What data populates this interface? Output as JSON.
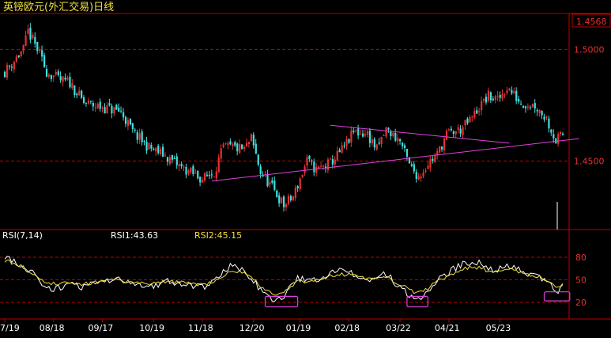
{
  "header": {
    "title": "英镑欧元(外汇交易)日线",
    "top_price": "1.4568"
  },
  "colors": {
    "background": "#000000",
    "frame": "#c00000",
    "grid": "#c00000",
    "up": "#e83030",
    "down": "#40e0e0",
    "trendline": "#e040e0",
    "rsi1": "#ffffff",
    "rsi2": "#f0e040",
    "axis_text": "#ffffff",
    "price_label": "#e83030",
    "title": "#f0e040"
  },
  "chart_data": [
    {
      "type": "candlestick",
      "title": "英镑欧元(外汇交易)日线",
      "ylim": [
        1.42,
        1.515
      ],
      "y_ticks": [
        {
          "value": 1.5,
          "label": "1.5000"
        },
        {
          "value": 1.45,
          "label": "1.4500"
        }
      ],
      "current_price_label": "1.4568",
      "x_labels": [
        "7/19",
        "08/18",
        "09/17",
        "10/19",
        "11/18",
        "12/20",
        "01/19",
        "02/18",
        "03/22",
        "04/21",
        "05/23"
      ],
      "x_label_index": [
        0,
        21,
        42,
        64,
        85,
        107,
        127,
        148,
        170,
        191,
        213
      ],
      "anchor_closes": [
        [
          0,
          1.49
        ],
        [
          8,
          1.5
        ],
        [
          10,
          1.508
        ],
        [
          14,
          1.5
        ],
        [
          18,
          1.49
        ],
        [
          24,
          1.486
        ],
        [
          28,
          1.485
        ],
        [
          34,
          1.476
        ],
        [
          42,
          1.474
        ],
        [
          50,
          1.472
        ],
        [
          55,
          1.463
        ],
        [
          62,
          1.456
        ],
        [
          68,
          1.453
        ],
        [
          76,
          1.447
        ],
        [
          85,
          1.442
        ],
        [
          90,
          1.445
        ],
        [
          94,
          1.456
        ],
        [
          98,
          1.456
        ],
        [
          103,
          1.455
        ],
        [
          106,
          1.46
        ],
        [
          110,
          1.445
        ],
        [
          115,
          1.438
        ],
        [
          120,
          1.43
        ],
        [
          124,
          1.434
        ],
        [
          130,
          1.45
        ],
        [
          134,
          1.446
        ],
        [
          140,
          1.449
        ],
        [
          146,
          1.456
        ],
        [
          150,
          1.463
        ],
        [
          156,
          1.462
        ],
        [
          160,
          1.455
        ],
        [
          164,
          1.464
        ],
        [
          170,
          1.459
        ],
        [
          174,
          1.448
        ],
        [
          178,
          1.443
        ],
        [
          182,
          1.449
        ],
        [
          186,
          1.453
        ],
        [
          190,
          1.462
        ],
        [
          196,
          1.464
        ],
        [
          200,
          1.468
        ],
        [
          204,
          1.474
        ],
        [
          208,
          1.479
        ],
        [
          212,
          1.477
        ],
        [
          216,
          1.483
        ],
        [
          222,
          1.476
        ],
        [
          228,
          1.475
        ],
        [
          233,
          1.469
        ],
        [
          237,
          1.459
        ],
        [
          240,
          1.462
        ]
      ],
      "trendlines": [
        {
          "points": [
            [
              89,
              1.441
            ],
            [
              247,
              1.46
            ]
          ]
        },
        {
          "points": [
            [
              140,
              1.466
            ],
            [
              217,
              1.458
            ]
          ]
        }
      ]
    },
    {
      "type": "line",
      "title": "RSI(7,14)",
      "series": [
        {
          "name": "RSI1",
          "current": 43.63,
          "anchors": [
            [
              0,
              82
            ],
            [
              6,
              72
            ],
            [
              12,
              60
            ],
            [
              16,
              42
            ],
            [
              22,
              38
            ],
            [
              28,
              45
            ],
            [
              34,
              40
            ],
            [
              42,
              48
            ],
            [
              48,
              52
            ],
            [
              56,
              44
            ],
            [
              62,
              41
            ],
            [
              70,
              48
            ],
            [
              78,
              44
            ],
            [
              85,
              40
            ],
            [
              92,
              52
            ],
            [
              97,
              70
            ],
            [
              102,
              62
            ],
            [
              108,
              45
            ],
            [
              112,
              30
            ],
            [
              116,
              24
            ],
            [
              120,
              28
            ],
            [
              126,
              52
            ],
            [
              132,
              48
            ],
            [
              138,
              56
            ],
            [
              144,
              62
            ],
            [
              150,
              58
            ],
            [
              158,
              48
            ],
            [
              164,
              58
            ],
            [
              170,
              40
            ],
            [
              176,
              26
            ],
            [
              180,
              28
            ],
            [
              186,
              48
            ],
            [
              192,
              62
            ],
            [
              198,
              74
            ],
            [
              204,
              72
            ],
            [
              210,
              62
            ],
            [
              216,
              70
            ],
            [
              222,
              62
            ],
            [
              228,
              56
            ],
            [
              234,
              45
            ],
            [
              237,
              32
            ],
            [
              240,
              43.63
            ]
          ]
        },
        {
          "name": "RSI2",
          "current": 45.15,
          "anchors": [
            [
              0,
              76
            ],
            [
              6,
              70
            ],
            [
              12,
              58
            ],
            [
              16,
              48
            ],
            [
              22,
              45
            ],
            [
              28,
              47
            ],
            [
              34,
              44
            ],
            [
              42,
              48
            ],
            [
              48,
              50
            ],
            [
              56,
              46
            ],
            [
              62,
              44
            ],
            [
              70,
              48
            ],
            [
              78,
              46
            ],
            [
              85,
              43
            ],
            [
              92,
              50
            ],
            [
              97,
              62
            ],
            [
              102,
              60
            ],
            [
              108,
              48
            ],
            [
              112,
              36
            ],
            [
              116,
              30
            ],
            [
              120,
              32
            ],
            [
              126,
              48
            ],
            [
              132,
              48
            ],
            [
              138,
              53
            ],
            [
              144,
              58
            ],
            [
              150,
              56
            ],
            [
              158,
              50
            ],
            [
              164,
              54
            ],
            [
              170,
              44
            ],
            [
              176,
              33
            ],
            [
              180,
              34
            ],
            [
              186,
              48
            ],
            [
              192,
              58
            ],
            [
              198,
              66
            ],
            [
              204,
              66
            ],
            [
              210,
              60
            ],
            [
              216,
              66
            ],
            [
              222,
              60
            ],
            [
              228,
              56
            ],
            [
              234,
              48
            ],
            [
              237,
              40
            ],
            [
              240,
              45.15
            ]
          ]
        }
      ],
      "ylim": [
        0,
        100
      ],
      "y_ticks": [
        {
          "value": 80,
          "label": "80"
        },
        {
          "value": 50,
          "label": "50"
        },
        {
          "value": 20,
          "label": "20"
        }
      ],
      "labels": {
        "indicator": "RSI(7,14)",
        "rsi1": "RSI1:43.63",
        "rsi2": "RSI2:45.15"
      },
      "highlight_boxes": [
        {
          "x": [
            112,
            126
          ],
          "y": [
            14,
            28
          ]
        },
        {
          "x": [
            173,
            182
          ],
          "y": [
            14,
            28
          ]
        },
        {
          "x": [
            232,
            243
          ],
          "y": [
            22,
            34
          ]
        }
      ]
    }
  ]
}
